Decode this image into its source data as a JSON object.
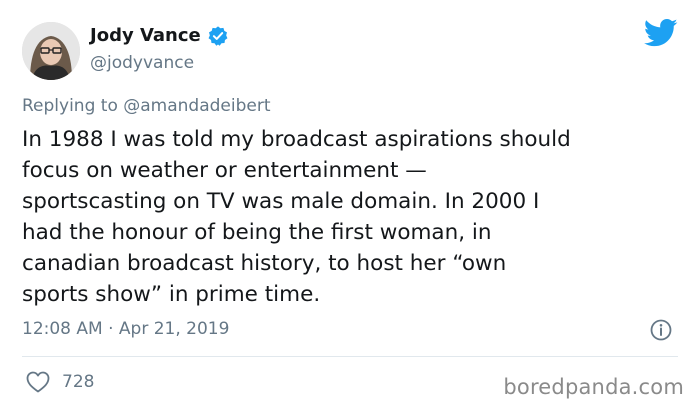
{
  "author": {
    "name": "Jody Vance",
    "handle": "@jodyvance",
    "verified": true
  },
  "reply": {
    "prefix": "Replying to",
    "mention": "@amandadeibert"
  },
  "tweet": {
    "text": "In 1988 I was told my broadcast aspirations should\nfocus on weather or entertainment —\nsportscasting on TV was male domain. In 2000 I\nhad the honour of being the first woman, in\ncanadian broadcast history, to host her “own\nsports show” in prime time.",
    "timestamp": "12:08 AM · Apr 21, 2019",
    "likes": "728"
  },
  "icons": {
    "brand": "twitter-bird-icon",
    "verified": "verified-badge-icon",
    "info": "info-icon",
    "like": "heart-icon"
  },
  "colors": {
    "twitter_blue": "#1da1f2",
    "secondary_text": "#657786",
    "primary_text": "#14171a",
    "divider": "#e1e8ed"
  },
  "watermark": "boredpanda.com"
}
